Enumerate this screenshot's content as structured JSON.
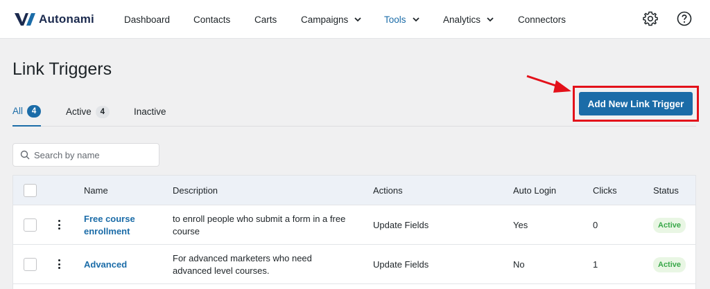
{
  "brand": {
    "name": "Autonami",
    "accent": "#1b6ca8"
  },
  "nav": {
    "dashboard": "Dashboard",
    "contacts": "Contacts",
    "carts": "Carts",
    "campaigns": "Campaigns",
    "tools": "Tools",
    "analytics": "Analytics",
    "connectors": "Connectors"
  },
  "header_icons": [
    "gear-icon",
    "help-icon"
  ],
  "page": {
    "title": "Link Triggers"
  },
  "tabs": [
    {
      "label": "All",
      "count": "4"
    },
    {
      "label": "Active",
      "count": "4"
    },
    {
      "label": "Inactive"
    }
  ],
  "actions": {
    "add_label": "Add New Link Trigger"
  },
  "search": {
    "placeholder": "Search by name"
  },
  "table": {
    "columns": [
      "Name",
      "Description",
      "Actions",
      "Auto Login",
      "Clicks",
      "Status"
    ],
    "rows": [
      {
        "name_line1": "Free course",
        "name_line2": "enrollment",
        "desc_line1": "to enroll people who submit a form in a free",
        "desc_line2": "course",
        "actions": "Update Fields",
        "auto_login": "Yes",
        "clicks": "0",
        "status": "Active"
      },
      {
        "name_line1": "Advanced",
        "name_line2": "",
        "desc_line1": "For advanced marketers who need",
        "desc_line2": "advanced level courses.",
        "actions": "Update Fields",
        "auto_login": "No",
        "clicks": "1",
        "status": "Active"
      }
    ]
  }
}
